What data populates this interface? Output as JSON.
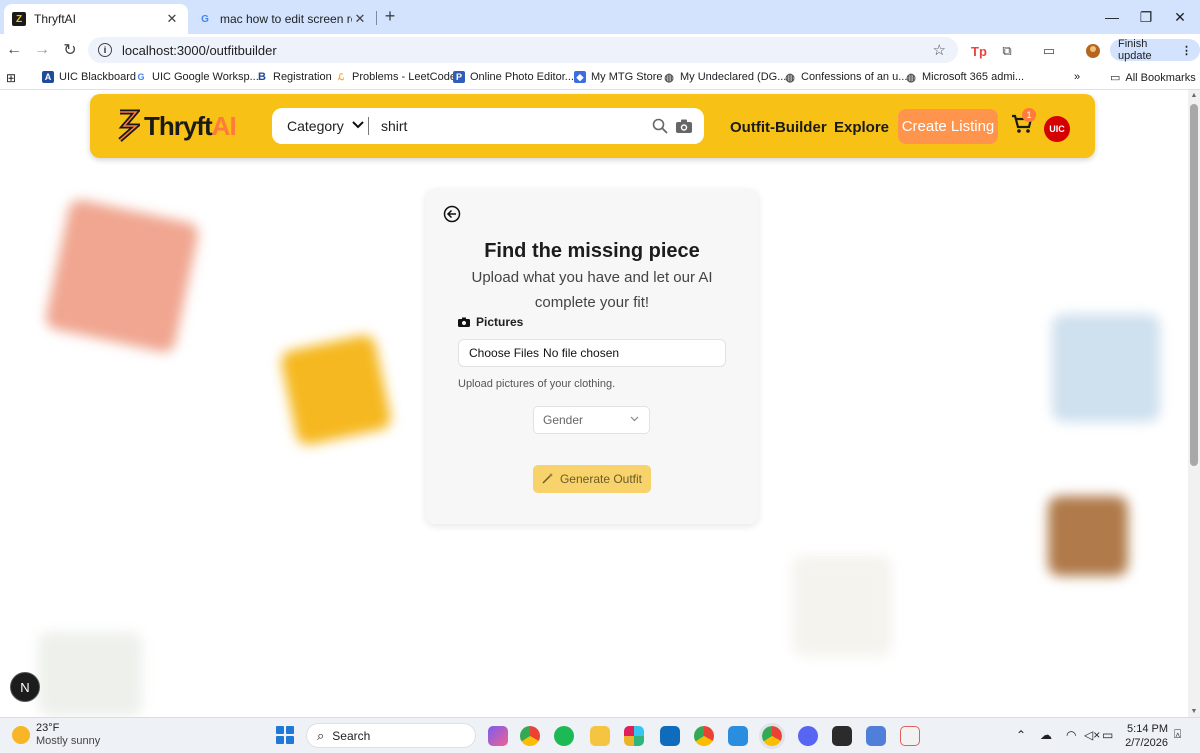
{
  "browser": {
    "tabs": [
      {
        "title": "ThryftAI",
        "active": true
      },
      {
        "title": "mac how to edit screen recordi",
        "active": false
      }
    ],
    "url": "localhost:3000/outfitbuilder",
    "finish_update": "Finish update",
    "bookmarks": [
      "UIC Blackboard",
      "UIC Google Worksp...",
      "Registration",
      "Problems - LeetCode",
      "Online Photo Editor...",
      "My MTG Store",
      "My Undeclared (DG...",
      "Confessions of an u...",
      "Microsoft 365 admi..."
    ],
    "all_bookmarks": "All Bookmarks",
    "more_bookmarks": "»"
  },
  "header": {
    "logo_part1": "Thryft",
    "logo_part2": "AI",
    "category_label": "Category",
    "search_value": "shirt",
    "nav_outfit_builder": "Outfit-Builder",
    "nav_explore": "Explore",
    "create_listing": "Create Listing",
    "cart_count": "1",
    "avatar_text": "UIC"
  },
  "card": {
    "title": "Find the missing piece",
    "subtitle": "Upload what you have and let our AI complete your fit!",
    "pictures_label": "Pictures",
    "choose_files": "Choose Files",
    "no_file": "No file chosen",
    "upload_hint": "Upload pictures of your clothing.",
    "gender_placeholder": "Gender",
    "generate_label": "Generate Outfit"
  },
  "dev_badge": "N",
  "taskbar": {
    "temperature": "23°F",
    "weather": "Mostly sunny",
    "search": "Search",
    "time": "5:14 PM",
    "date": "2/7/2026"
  }
}
